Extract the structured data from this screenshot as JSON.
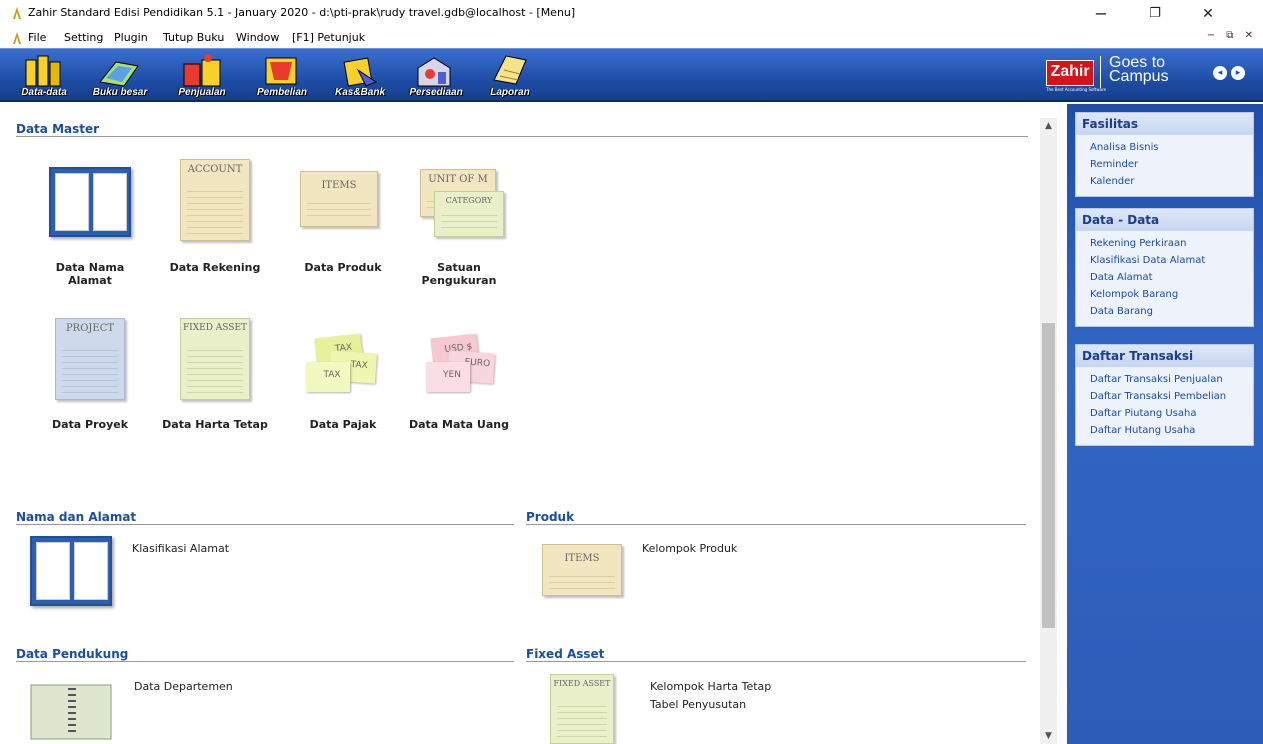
{
  "window": {
    "title": "Zahir Standard Edisi Pendidikan 5.1 - January 2020 - d:\\pti-prak\\rudy travel.gdb@localhost - [Menu]",
    "minimize": "−",
    "restore": "❐",
    "close": "✕"
  },
  "menu": {
    "items": [
      "File",
      "Setting",
      "Plugin",
      "Tutup Buku",
      "Window",
      "[F1] Petunjuk"
    ],
    "mdi_controls": "− ⧉ ✕"
  },
  "toolbar": {
    "buttons": [
      {
        "label": "Data-data",
        "icon": "data-data-icon"
      },
      {
        "label": "Buku besar",
        "icon": "ledger-icon"
      },
      {
        "label": "Penjualan",
        "icon": "sales-gift-icon"
      },
      {
        "label": "Pembelian",
        "icon": "purchase-icon"
      },
      {
        "label": "Kas&Bank",
        "icon": "cash-bank-icon"
      },
      {
        "label": "Persediaan",
        "icon": "inventory-icon"
      },
      {
        "label": "Laporan",
        "icon": "report-scroll-icon"
      }
    ],
    "brand": "Zahir",
    "brand_tagline": "The Best Accounting Software",
    "campus_line1": "Goes to",
    "campus_line2": "Campus"
  },
  "main": {
    "data_master": {
      "title": "Data Master",
      "items": [
        {
          "label": "Data Nama Alamat",
          "icon": "address-book-icon"
        },
        {
          "label": "Data Rekening",
          "icon": "account-sheet-icon",
          "sheet": "ACCOUNT"
        },
        {
          "label": "Data Produk",
          "icon": "items-sheet-icon",
          "sheet": "ITEMS"
        },
        {
          "label": "Satuan Pengukuran",
          "icon": "unit-category-icon",
          "sheet": "UNIT OF M",
          "sheet2": "CATEGORY"
        },
        {
          "label": "Data Proyek",
          "icon": "project-sheet-icon",
          "sheet": "PROJECT"
        },
        {
          "label": "Data Harta Tetap",
          "icon": "fixed-asset-sheet-icon",
          "sheet": "FIXED ASSET"
        },
        {
          "label": "Data Pajak",
          "icon": "tax-notes-icon",
          "notes": [
            "TAX",
            "TAX",
            "TAX"
          ]
        },
        {
          "label": "Data Mata Uang",
          "icon": "currency-notes-icon",
          "notes": [
            "USD $",
            "EURO",
            "YEN"
          ]
        }
      ]
    },
    "nama_alamat": {
      "title": "Nama dan Alamat",
      "link": "Klasifikasi Alamat"
    },
    "produk": {
      "title": "Produk",
      "link": "Kelompok Produk",
      "sheet": "ITEMS"
    },
    "pendukung": {
      "title": "Data Pendukung",
      "link": "Data Departemen"
    },
    "fixed_asset": {
      "title": "Fixed Asset",
      "links": [
        "Kelompok Harta Tetap",
        "Tabel Penyusutan"
      ],
      "sheet": "FIXED ASSET"
    }
  },
  "sidebar": {
    "fasilitas": {
      "title": "Fasilitas",
      "items": [
        "Analisa Bisnis",
        "Reminder",
        "Kalender"
      ]
    },
    "data": {
      "title": "Data - Data",
      "items": [
        "Rekening Perkiraan",
        "Klasifikasi Data Alamat",
        "Data Alamat",
        "Kelompok Barang",
        "Data Barang"
      ]
    },
    "transaksi": {
      "title": "Daftar Transaksi",
      "items": [
        "Daftar Transaksi Penjualan",
        "Daftar Transaksi Pembelian",
        "Daftar Piutang Usaha",
        "Daftar Hutang Usaha"
      ]
    }
  },
  "colors": {
    "accent": "#1a4ea0",
    "toolbar": "#1f4ea8",
    "brand_red": "#d6121b"
  }
}
